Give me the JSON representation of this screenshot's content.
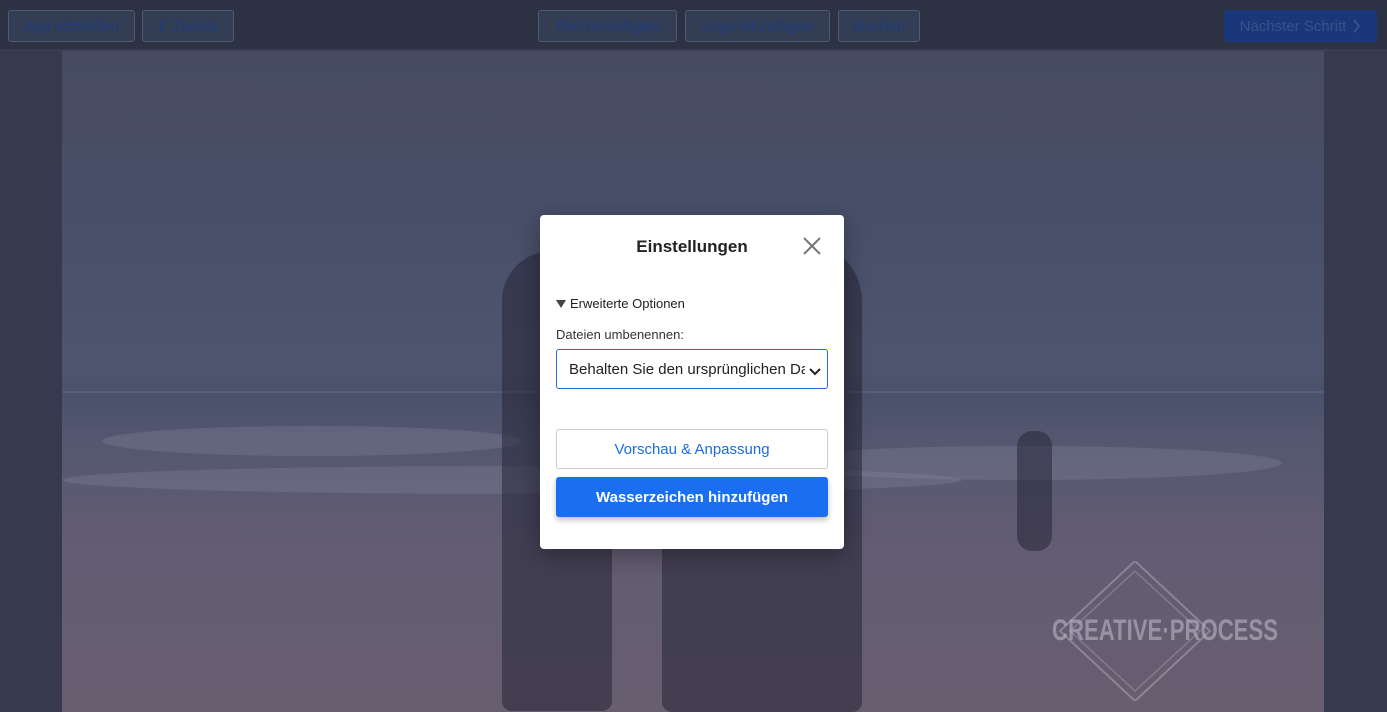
{
  "toolbar": {
    "close_app_label": "App schließen",
    "back_label": "Zurück",
    "add_text_label": "Text hinzufügen",
    "add_logo_label": "Logo hinzufügen",
    "delete_label": "löschen",
    "next_step_label": "Nächster Schritt"
  },
  "watermark": {
    "text": "CREATIVE·PROCESS"
  },
  "modal": {
    "title": "Einstellungen",
    "advanced_options_label": "Erweiterte Optionen",
    "rename_files_label": "Dateien umbenennen:",
    "rename_select_value": "Behalten Sie den ursprünglichen Dateinamen bei",
    "preview_button_label": "Vorschau & Anpassung",
    "add_watermark_button_label": "Wasserzeichen hinzufügen"
  },
  "colors": {
    "primary": "#1a6ff0",
    "link": "#1a6de0",
    "toolbar_bg": "#2e3446"
  },
  "icons": {
    "back": "chevron-left-icon",
    "next": "chevron-right-icon",
    "close": "close-icon",
    "advanced": "triangle-down-icon",
    "select": "chevron-down-icon"
  }
}
